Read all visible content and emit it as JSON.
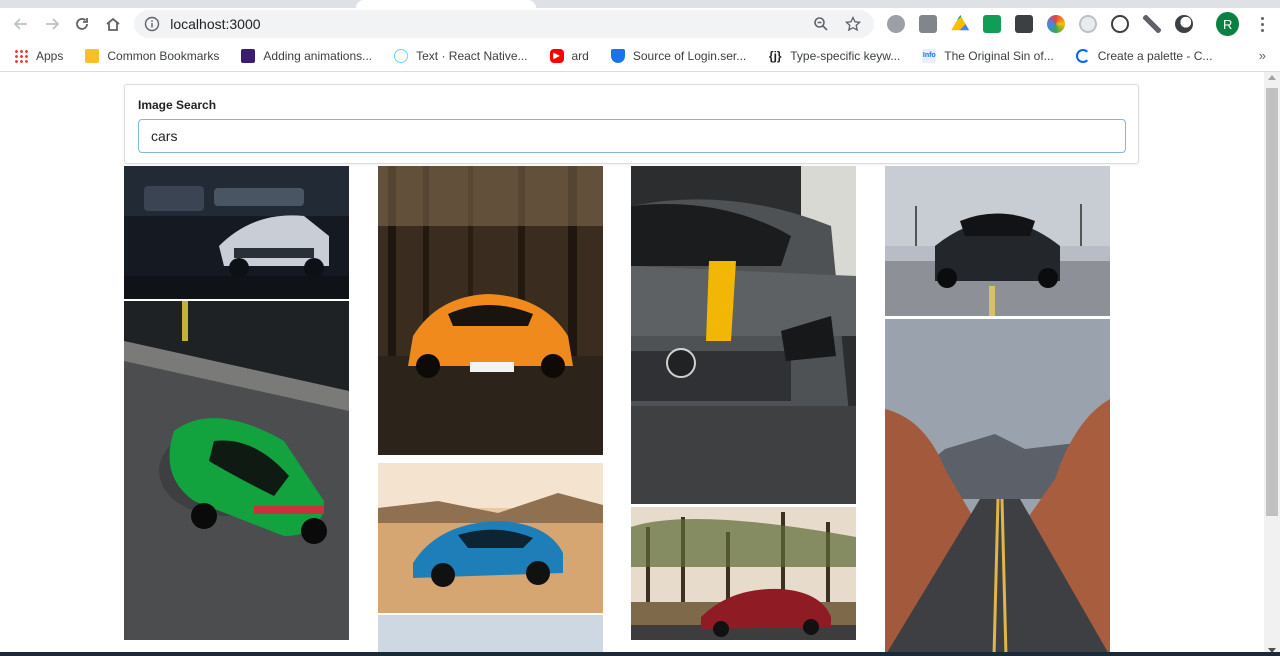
{
  "browser": {
    "url": "localhost:3000",
    "profile_initial": "R",
    "bookmarks": [
      {
        "label": "Apps",
        "icon": "apps-grid-icon"
      },
      {
        "label": "Common Bookmarks",
        "icon": "folder-icon"
      },
      {
        "label": "Adding animations...",
        "icon": "bookmark-favicon"
      },
      {
        "label": "Text · React Native...",
        "icon": "react-icon"
      },
      {
        "label": "ard",
        "icon": "youtube-icon"
      },
      {
        "label": "Source of Login.ser...",
        "icon": "shield-icon"
      },
      {
        "label": "Type-specific keyw...",
        "icon": "json-icon"
      },
      {
        "label": "The Original Sin of...",
        "icon": "infoq-icon"
      },
      {
        "label": "Create a palette - C...",
        "icon": "coolors-icon"
      }
    ]
  },
  "search": {
    "label": "Image Search",
    "value": "cars"
  },
  "images": [
    {
      "name": "white-sports-car-garage-image"
    },
    {
      "name": "green-mustang-top-view-image"
    },
    {
      "name": "orange-lamborghini-forest-image"
    },
    {
      "name": "blue-camaro-desert-image"
    },
    {
      "name": "mercedes-yellow-stripe-image"
    },
    {
      "name": "red-amg-gt-trees-image"
    },
    {
      "name": "black-mustang-front-image"
    },
    {
      "name": "desert-road-canyon-image"
    }
  ],
  "colors": {
    "accent_focus": "#85b7d9",
    "profile": "#0b8043"
  }
}
